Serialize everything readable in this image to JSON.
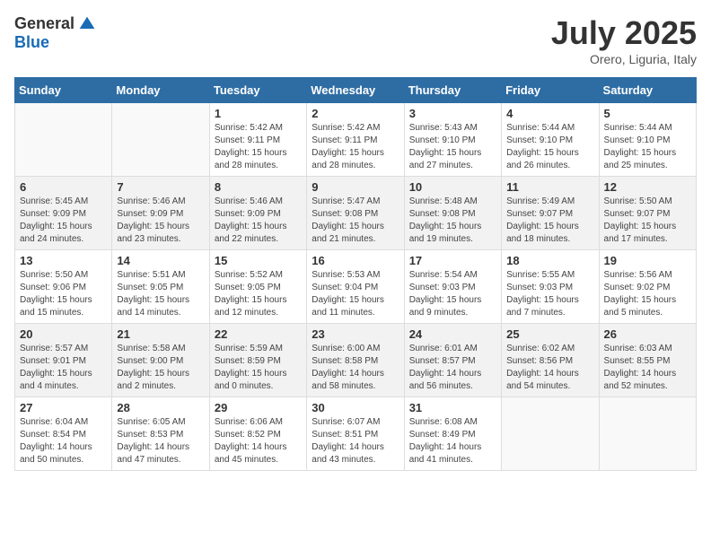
{
  "header": {
    "logo_general": "General",
    "logo_blue": "Blue",
    "month_title": "July 2025",
    "location": "Orero, Liguria, Italy"
  },
  "weekdays": [
    "Sunday",
    "Monday",
    "Tuesday",
    "Wednesday",
    "Thursday",
    "Friday",
    "Saturday"
  ],
  "weeks": [
    [
      {
        "day": "",
        "info": ""
      },
      {
        "day": "",
        "info": ""
      },
      {
        "day": "1",
        "info": "Sunrise: 5:42 AM\nSunset: 9:11 PM\nDaylight: 15 hours and 28 minutes."
      },
      {
        "day": "2",
        "info": "Sunrise: 5:42 AM\nSunset: 9:11 PM\nDaylight: 15 hours and 28 minutes."
      },
      {
        "day": "3",
        "info": "Sunrise: 5:43 AM\nSunset: 9:10 PM\nDaylight: 15 hours and 27 minutes."
      },
      {
        "day": "4",
        "info": "Sunrise: 5:44 AM\nSunset: 9:10 PM\nDaylight: 15 hours and 26 minutes."
      },
      {
        "day": "5",
        "info": "Sunrise: 5:44 AM\nSunset: 9:10 PM\nDaylight: 15 hours and 25 minutes."
      }
    ],
    [
      {
        "day": "6",
        "info": "Sunrise: 5:45 AM\nSunset: 9:09 PM\nDaylight: 15 hours and 24 minutes."
      },
      {
        "day": "7",
        "info": "Sunrise: 5:46 AM\nSunset: 9:09 PM\nDaylight: 15 hours and 23 minutes."
      },
      {
        "day": "8",
        "info": "Sunrise: 5:46 AM\nSunset: 9:09 PM\nDaylight: 15 hours and 22 minutes."
      },
      {
        "day": "9",
        "info": "Sunrise: 5:47 AM\nSunset: 9:08 PM\nDaylight: 15 hours and 21 minutes."
      },
      {
        "day": "10",
        "info": "Sunrise: 5:48 AM\nSunset: 9:08 PM\nDaylight: 15 hours and 19 minutes."
      },
      {
        "day": "11",
        "info": "Sunrise: 5:49 AM\nSunset: 9:07 PM\nDaylight: 15 hours and 18 minutes."
      },
      {
        "day": "12",
        "info": "Sunrise: 5:50 AM\nSunset: 9:07 PM\nDaylight: 15 hours and 17 minutes."
      }
    ],
    [
      {
        "day": "13",
        "info": "Sunrise: 5:50 AM\nSunset: 9:06 PM\nDaylight: 15 hours and 15 minutes."
      },
      {
        "day": "14",
        "info": "Sunrise: 5:51 AM\nSunset: 9:05 PM\nDaylight: 15 hours and 14 minutes."
      },
      {
        "day": "15",
        "info": "Sunrise: 5:52 AM\nSunset: 9:05 PM\nDaylight: 15 hours and 12 minutes."
      },
      {
        "day": "16",
        "info": "Sunrise: 5:53 AM\nSunset: 9:04 PM\nDaylight: 15 hours and 11 minutes."
      },
      {
        "day": "17",
        "info": "Sunrise: 5:54 AM\nSunset: 9:03 PM\nDaylight: 15 hours and 9 minutes."
      },
      {
        "day": "18",
        "info": "Sunrise: 5:55 AM\nSunset: 9:03 PM\nDaylight: 15 hours and 7 minutes."
      },
      {
        "day": "19",
        "info": "Sunrise: 5:56 AM\nSunset: 9:02 PM\nDaylight: 15 hours and 5 minutes."
      }
    ],
    [
      {
        "day": "20",
        "info": "Sunrise: 5:57 AM\nSunset: 9:01 PM\nDaylight: 15 hours and 4 minutes."
      },
      {
        "day": "21",
        "info": "Sunrise: 5:58 AM\nSunset: 9:00 PM\nDaylight: 15 hours and 2 minutes."
      },
      {
        "day": "22",
        "info": "Sunrise: 5:59 AM\nSunset: 8:59 PM\nDaylight: 15 hours and 0 minutes."
      },
      {
        "day": "23",
        "info": "Sunrise: 6:00 AM\nSunset: 8:58 PM\nDaylight: 14 hours and 58 minutes."
      },
      {
        "day": "24",
        "info": "Sunrise: 6:01 AM\nSunset: 8:57 PM\nDaylight: 14 hours and 56 minutes."
      },
      {
        "day": "25",
        "info": "Sunrise: 6:02 AM\nSunset: 8:56 PM\nDaylight: 14 hours and 54 minutes."
      },
      {
        "day": "26",
        "info": "Sunrise: 6:03 AM\nSunset: 8:55 PM\nDaylight: 14 hours and 52 minutes."
      }
    ],
    [
      {
        "day": "27",
        "info": "Sunrise: 6:04 AM\nSunset: 8:54 PM\nDaylight: 14 hours and 50 minutes."
      },
      {
        "day": "28",
        "info": "Sunrise: 6:05 AM\nSunset: 8:53 PM\nDaylight: 14 hours and 47 minutes."
      },
      {
        "day": "29",
        "info": "Sunrise: 6:06 AM\nSunset: 8:52 PM\nDaylight: 14 hours and 45 minutes."
      },
      {
        "day": "30",
        "info": "Sunrise: 6:07 AM\nSunset: 8:51 PM\nDaylight: 14 hours and 43 minutes."
      },
      {
        "day": "31",
        "info": "Sunrise: 6:08 AM\nSunset: 8:49 PM\nDaylight: 14 hours and 41 minutes."
      },
      {
        "day": "",
        "info": ""
      },
      {
        "day": "",
        "info": ""
      }
    ]
  ]
}
